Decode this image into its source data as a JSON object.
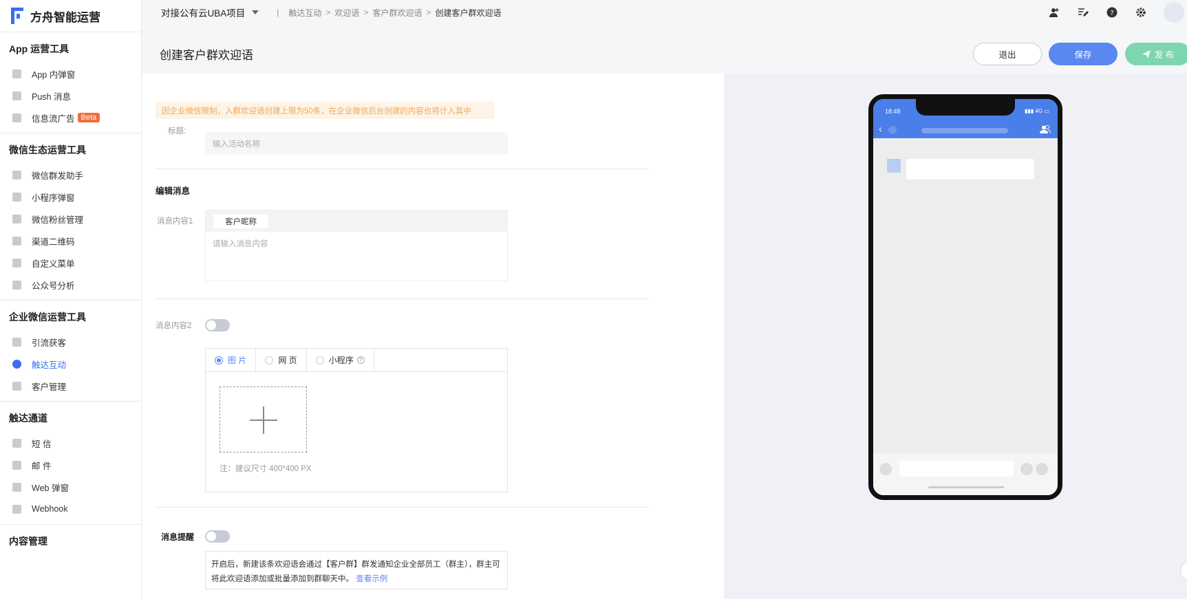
{
  "app": {
    "title": "方舟智能运营"
  },
  "sidebar": {
    "sections": [
      {
        "title": "App 运营工具",
        "items": [
          {
            "label": "App 内弹窗",
            "icon": "popup-icon"
          },
          {
            "label": "Push 消息",
            "icon": "megaphone-icon"
          },
          {
            "label": "信息流广告",
            "icon": "feed-icon",
            "badge": "Beta"
          }
        ]
      },
      {
        "title": "微信生态运营工具",
        "items": [
          {
            "label": "微信群发助手",
            "icon": "wechat-icon"
          },
          {
            "label": "小程序弹窗",
            "icon": "miniprogram-icon"
          },
          {
            "label": "微信粉丝管理",
            "icon": "fans-icon"
          },
          {
            "label": "渠道二维码",
            "icon": "qrcode-icon"
          },
          {
            "label": "自定义菜单",
            "icon": "menu-edit-icon"
          },
          {
            "label": "公众号分析",
            "icon": "doc-icon"
          }
        ]
      },
      {
        "title": "企业微信运营工具",
        "items": [
          {
            "label": "引流获客",
            "icon": "target-icon"
          },
          {
            "label": "触达互动",
            "icon": "interact-icon",
            "active": true
          },
          {
            "label": "客户管理",
            "icon": "gear-icon"
          }
        ]
      },
      {
        "title": "触达通道",
        "items": [
          {
            "label": "短 信",
            "icon": "sms-icon"
          },
          {
            "label": "邮 件",
            "icon": "mail-icon"
          },
          {
            "label": "Web 弹窗",
            "icon": "web-popup-icon"
          },
          {
            "label": "Webhook",
            "icon": "webhook-icon"
          }
        ]
      },
      {
        "title": "内容管理",
        "items": []
      }
    ]
  },
  "topbar": {
    "project": "对接公有云UBA项目",
    "divider": "|",
    "breadcrumb": [
      "触达互动",
      "欢迎语",
      "客户群欢迎语",
      "创建客户群欢迎语"
    ],
    "crumb_sep": ">",
    "icons": [
      "add-user-icon",
      "edit-list-icon",
      "help-icon",
      "settings-icon",
      "avatar"
    ]
  },
  "header": {
    "title": "创建客户群欢迎语",
    "exit": "退出",
    "save": "保存",
    "publish": "发 布"
  },
  "form": {
    "notice": "因企业微信限制，入群欢迎语创建上限为50条，在企业微信后台创建的内容也将计入其中",
    "title_label": "标题:",
    "title_placeholder": "输入活动名称",
    "edit_section": "编辑消息",
    "content1_label": "消息内容1",
    "nickname_chip": "客户昵称",
    "content1_placeholder": "请输入消息内容",
    "content2_label": "消息内容2",
    "content2_enabled": false,
    "media_tabs": [
      {
        "label": "图 片",
        "selected": true
      },
      {
        "label": "网 页",
        "selected": false
      },
      {
        "label": "小程序",
        "selected": false
      }
    ],
    "upload_hint": "注：建议尺寸 400*400 PX",
    "reminder_label": "消息提醒",
    "reminder_enabled": false,
    "reminder_desc": "开启后，新建该条欢迎语会通过【客户群】群发通知企业全部员工（群主），群主可将此欢迎语添加或批量添加到群聊天中。",
    "reminder_link": "查看示例"
  },
  "preview": {
    "time": "18:48",
    "network": "4G"
  },
  "colors": {
    "primary": "#3b6ef0",
    "save": "#5b87f0",
    "publish": "#7ed6b0",
    "notice_text": "#f0a85a"
  }
}
